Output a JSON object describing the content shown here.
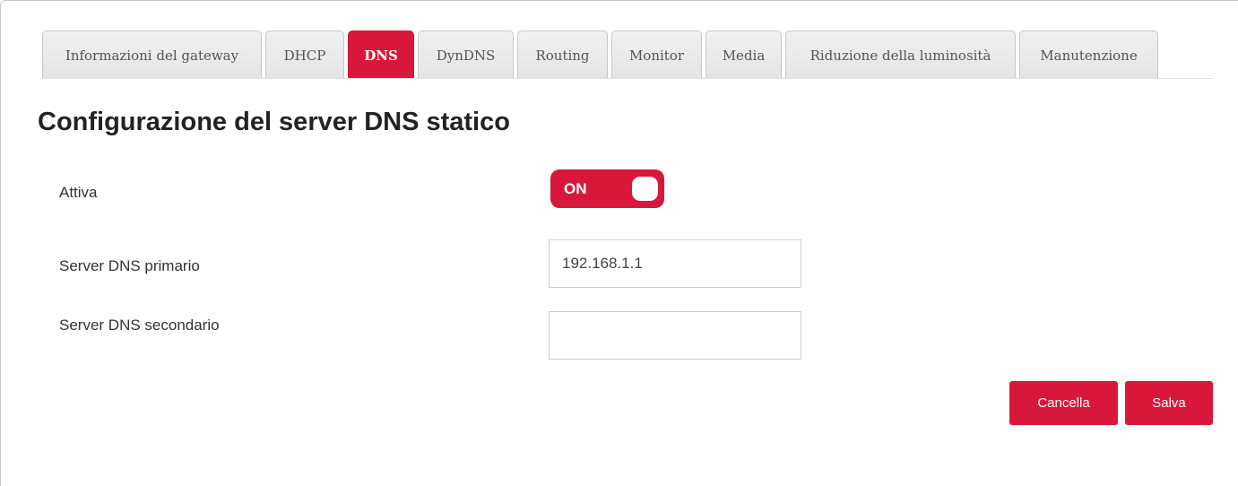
{
  "tabs": [
    {
      "label": "Informazioni del gateway"
    },
    {
      "label": "DHCP"
    },
    {
      "label": "DNS"
    },
    {
      "label": "DynDNS"
    },
    {
      "label": "Routing"
    },
    {
      "label": "Monitor"
    },
    {
      "label": "Media"
    },
    {
      "label": "Riduzione della luminosità"
    },
    {
      "label": "Manutenzione"
    }
  ],
  "active_tab": "DNS",
  "page_title": "Configurazione del server DNS statico",
  "form": {
    "enable_label": "Attiva",
    "enable_toggle_text": "ON",
    "primary_label": "Server DNS primario",
    "primary_value": "192.168.1.1",
    "secondary_label": "Server DNS secondario",
    "secondary_value": ""
  },
  "buttons": {
    "cancel_label": "Cancella",
    "save_label": "Salva"
  },
  "colors": {
    "accent": "#d8183a",
    "tab_inactive": "#e8e8e8"
  }
}
